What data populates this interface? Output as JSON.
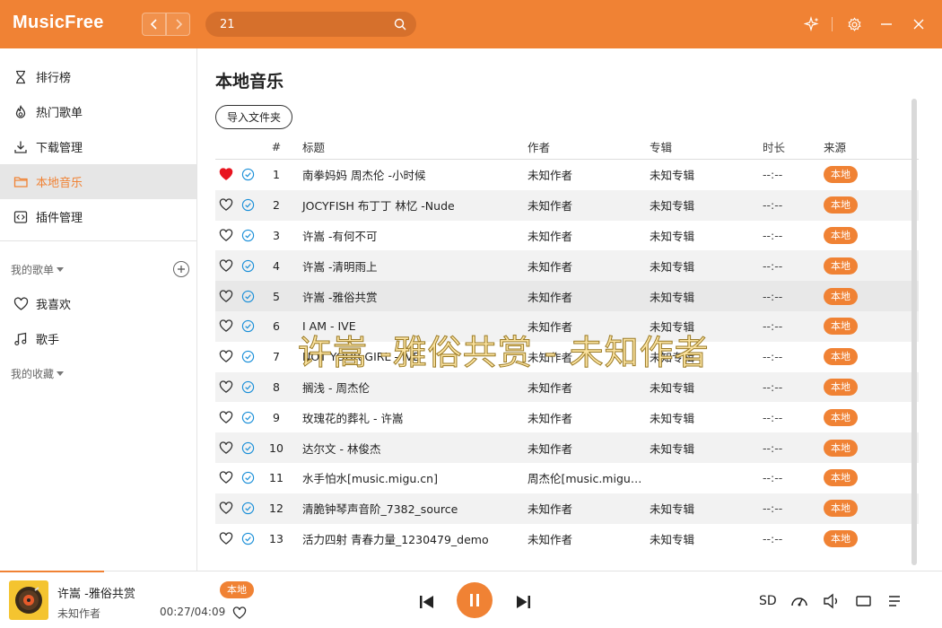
{
  "app": {
    "name": "MusicFree"
  },
  "search": {
    "value": "21"
  },
  "sidebar": {
    "items": [
      {
        "label": "排行榜",
        "icon": "trophy-icon"
      },
      {
        "label": "热门歌单",
        "icon": "fire-icon"
      },
      {
        "label": "下载管理",
        "icon": "download-icon"
      },
      {
        "label": "本地音乐",
        "icon": "folder-icon"
      },
      {
        "label": "插件管理",
        "icon": "plugin-icon"
      }
    ],
    "active_index": 3,
    "my_playlists_label": "我的歌单",
    "playlists": [
      {
        "label": "我喜欢",
        "icon": "heart-icon"
      },
      {
        "label": "歌手",
        "icon": "music-note-icon"
      }
    ],
    "my_collection_label": "我的收藏"
  },
  "main": {
    "title": "本地音乐",
    "import_label": "导入文件夹",
    "columns": {
      "num": "#",
      "title": "标题",
      "artist": "作者",
      "album": "专辑",
      "duration": "时长",
      "source": "来源"
    },
    "rows": [
      {
        "num": "1",
        "title": "南拳妈妈 周杰伦 -小时候",
        "artist": "未知作者",
        "album": "未知专辑",
        "duration": "--:--",
        "source": "本地",
        "liked": true
      },
      {
        "num": "2",
        "title": "JOCYFISH 布丁丁 林忆 -Nude",
        "artist": "未知作者",
        "album": "未知专辑",
        "duration": "--:--",
        "source": "本地",
        "liked": false
      },
      {
        "num": "3",
        "title": "许嵩 -有何不可",
        "artist": "未知作者",
        "album": "未知专辑",
        "duration": "--:--",
        "source": "本地",
        "liked": false
      },
      {
        "num": "4",
        "title": "许嵩 -清明雨上",
        "artist": "未知作者",
        "album": "未知专辑",
        "duration": "--:--",
        "source": "本地",
        "liked": false
      },
      {
        "num": "5",
        "title": "许嵩 -雅俗共赏",
        "artist": "未知作者",
        "album": "未知专辑",
        "duration": "--:--",
        "source": "本地",
        "liked": false
      },
      {
        "num": "6",
        "title": "I AM - IVE",
        "artist": "未知作者",
        "album": "未知专辑",
        "duration": "--:--",
        "source": "本地",
        "liked": false
      },
      {
        "num": "7",
        "title": "NOT YOUR GIRL - IVE",
        "artist": "未知作者",
        "album": "未知专辑",
        "duration": "--:--",
        "source": "本地",
        "liked": false
      },
      {
        "num": "8",
        "title": "搁浅 - 周杰伦",
        "artist": "未知作者",
        "album": "未知专辑",
        "duration": "--:--",
        "source": "本地",
        "liked": false
      },
      {
        "num": "9",
        "title": "玫瑰花的葬礼 - 许嵩",
        "artist": "未知作者",
        "album": "未知专辑",
        "duration": "--:--",
        "source": "本地",
        "liked": false
      },
      {
        "num": "10",
        "title": "达尔文 - 林俊杰",
        "artist": "未知作者",
        "album": "未知专辑",
        "duration": "--:--",
        "source": "本地",
        "liked": false
      },
      {
        "num": "11",
        "title": "水手怕水[music.migu.cn]",
        "artist": "周杰伦[music.migu....",
        "album": "",
        "duration": "--:--",
        "source": "本地",
        "liked": false
      },
      {
        "num": "12",
        "title": "清脆钟琴声音阶_7382_source",
        "artist": "未知作者",
        "album": "未知专辑",
        "duration": "--:--",
        "source": "本地",
        "liked": false
      },
      {
        "num": "13",
        "title": "活力四射 青春力量_1230479_demo",
        "artist": "未知作者",
        "album": "未知专辑",
        "duration": "--:--",
        "source": "本地",
        "liked": false
      }
    ]
  },
  "lyric_overlay": "许嵩 -雅俗共赏 - 未知作者",
  "player": {
    "title": "许嵩 -雅俗共赏",
    "artist": "未知作者",
    "source": "本地",
    "time": "00:27/04:09",
    "progress": 0.11,
    "quality": "SD"
  },
  "colors": {
    "accent": "#f08234",
    "liked": "#e8141f",
    "check": "#1a8fd8"
  }
}
